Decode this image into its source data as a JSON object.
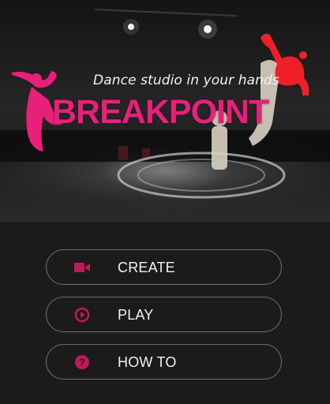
{
  "hero": {
    "tagline": "Dance studio in your hands",
    "logo_text": "BREAKPOINT"
  },
  "menu": {
    "items": [
      {
        "label": "CREATE",
        "icon": "video-camera-icon"
      },
      {
        "label": "PLAY",
        "icon": "play-circle-icon"
      },
      {
        "label": "HOW TO",
        "icon": "help-circle-icon"
      }
    ]
  },
  "colors": {
    "accent": "#e8207a",
    "icon": "#c2195e",
    "button_border": "#6d6d6d",
    "background": "#1b1b1b",
    "text": "#f1f1f1"
  }
}
